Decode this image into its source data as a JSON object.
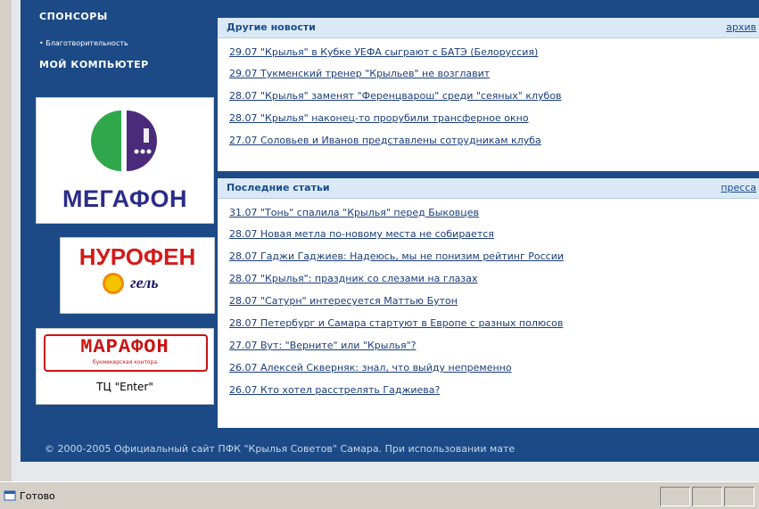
{
  "sidebar": {
    "sponsors_heading": "СПОНСОРЫ",
    "charity_link": "• Благотворительность",
    "mycomputer_heading": "МОЙ КОМПЬЮТЕР",
    "megafon_logo": "МЕГАФОН",
    "nurofen_logo": "НУРОФЕН",
    "nurofen_sub": "гель",
    "marathon_logo": "МАРАФОН",
    "marathon_sub": "букмекерская контора",
    "marathon_caption": "ТЦ \"Enter\""
  },
  "other_news": {
    "title": "Другие новости",
    "more_link": "архив",
    "items": [
      "29.07 \"Крылья\" в Кубке УЕФА сыграют с БАТЭ (Белоруссия)",
      "29.07 Тукменский тренер \"Крыльев\" не возглавит",
      "28.07 \"Крылья\" заменят \"Ференцварош\" среди \"сеяных\" клубов",
      "28.07 \"Крылья\" наконец-то прорубили трансферное окно",
      "27.07 Соловьев и Иванов представлены сотрудникам клуба"
    ]
  },
  "latest_articles": {
    "title": "Последние статьи",
    "more_link": "пресса",
    "items": [
      "31.07 \"Тонь\" спалила \"Крылья\" перед Быковцев",
      "28.07 Новая метла по-новому места не собирается",
      "28.07 Гаджи Гаджиев: Надеюсь, мы не понизим рейтинг России",
      "28.07 \"Крылья\": праздник со слезами на глазах",
      "28.07 \"Сатурн\" интересуется Маттью Бутон",
      "28.07 Петербург и Самара стартуют в Европе с разных полюсов",
      "27.07 Вут: \"Верните\" или \"Крылья\"?",
      "26.07 Алексей Скверняк: знал, что выйду непременно",
      "26.07 Кто хотел расстрелять Гаджиева?"
    ]
  },
  "footer": {
    "copyright": "© 2000-2005 Официальный сайт ПФК \"Крылья Советов\" Самара. При использовании мате"
  },
  "statusbar": {
    "text": "Готово"
  }
}
